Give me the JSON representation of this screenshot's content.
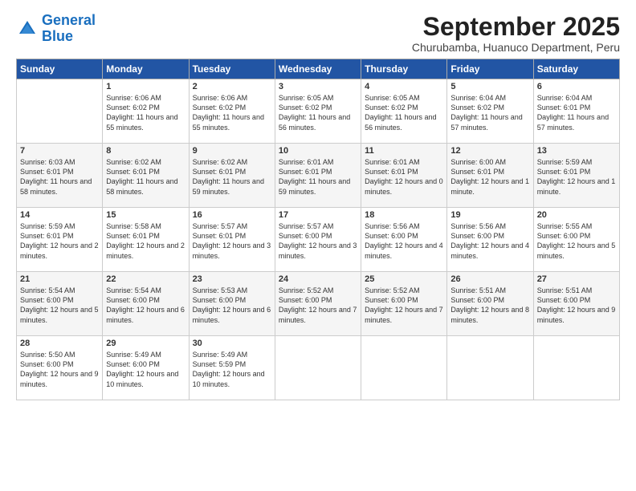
{
  "header": {
    "logo_line1": "General",
    "logo_line2": "Blue",
    "month": "September 2025",
    "location": "Churubamba, Huanuco Department, Peru"
  },
  "days_of_week": [
    "Sunday",
    "Monday",
    "Tuesday",
    "Wednesday",
    "Thursday",
    "Friday",
    "Saturday"
  ],
  "weeks": [
    [
      {
        "day": "",
        "sunrise": "",
        "sunset": "",
        "daylight": ""
      },
      {
        "day": "1",
        "sunrise": "6:06 AM",
        "sunset": "6:02 PM",
        "daylight": "11 hours and 55 minutes."
      },
      {
        "day": "2",
        "sunrise": "6:06 AM",
        "sunset": "6:02 PM",
        "daylight": "11 hours and 55 minutes."
      },
      {
        "day": "3",
        "sunrise": "6:05 AM",
        "sunset": "6:02 PM",
        "daylight": "11 hours and 56 minutes."
      },
      {
        "day": "4",
        "sunrise": "6:05 AM",
        "sunset": "6:02 PM",
        "daylight": "11 hours and 56 minutes."
      },
      {
        "day": "5",
        "sunrise": "6:04 AM",
        "sunset": "6:02 PM",
        "daylight": "11 hours and 57 minutes."
      },
      {
        "day": "6",
        "sunrise": "6:04 AM",
        "sunset": "6:01 PM",
        "daylight": "11 hours and 57 minutes."
      }
    ],
    [
      {
        "day": "7",
        "sunrise": "6:03 AM",
        "sunset": "6:01 PM",
        "daylight": "11 hours and 58 minutes."
      },
      {
        "day": "8",
        "sunrise": "6:02 AM",
        "sunset": "6:01 PM",
        "daylight": "11 hours and 58 minutes."
      },
      {
        "day": "9",
        "sunrise": "6:02 AM",
        "sunset": "6:01 PM",
        "daylight": "11 hours and 59 minutes."
      },
      {
        "day": "10",
        "sunrise": "6:01 AM",
        "sunset": "6:01 PM",
        "daylight": "11 hours and 59 minutes."
      },
      {
        "day": "11",
        "sunrise": "6:01 AM",
        "sunset": "6:01 PM",
        "daylight": "12 hours and 0 minutes."
      },
      {
        "day": "12",
        "sunrise": "6:00 AM",
        "sunset": "6:01 PM",
        "daylight": "12 hours and 1 minute."
      },
      {
        "day": "13",
        "sunrise": "5:59 AM",
        "sunset": "6:01 PM",
        "daylight": "12 hours and 1 minute."
      }
    ],
    [
      {
        "day": "14",
        "sunrise": "5:59 AM",
        "sunset": "6:01 PM",
        "daylight": "12 hours and 2 minutes."
      },
      {
        "day": "15",
        "sunrise": "5:58 AM",
        "sunset": "6:01 PM",
        "daylight": "12 hours and 2 minutes."
      },
      {
        "day": "16",
        "sunrise": "5:57 AM",
        "sunset": "6:01 PM",
        "daylight": "12 hours and 3 minutes."
      },
      {
        "day": "17",
        "sunrise": "5:57 AM",
        "sunset": "6:00 PM",
        "daylight": "12 hours and 3 minutes."
      },
      {
        "day": "18",
        "sunrise": "5:56 AM",
        "sunset": "6:00 PM",
        "daylight": "12 hours and 4 minutes."
      },
      {
        "day": "19",
        "sunrise": "5:56 AM",
        "sunset": "6:00 PM",
        "daylight": "12 hours and 4 minutes."
      },
      {
        "day": "20",
        "sunrise": "5:55 AM",
        "sunset": "6:00 PM",
        "daylight": "12 hours and 5 minutes."
      }
    ],
    [
      {
        "day": "21",
        "sunrise": "5:54 AM",
        "sunset": "6:00 PM",
        "daylight": "12 hours and 5 minutes."
      },
      {
        "day": "22",
        "sunrise": "5:54 AM",
        "sunset": "6:00 PM",
        "daylight": "12 hours and 6 minutes."
      },
      {
        "day": "23",
        "sunrise": "5:53 AM",
        "sunset": "6:00 PM",
        "daylight": "12 hours and 6 minutes."
      },
      {
        "day": "24",
        "sunrise": "5:52 AM",
        "sunset": "6:00 PM",
        "daylight": "12 hours and 7 minutes."
      },
      {
        "day": "25",
        "sunrise": "5:52 AM",
        "sunset": "6:00 PM",
        "daylight": "12 hours and 7 minutes."
      },
      {
        "day": "26",
        "sunrise": "5:51 AM",
        "sunset": "6:00 PM",
        "daylight": "12 hours and 8 minutes."
      },
      {
        "day": "27",
        "sunrise": "5:51 AM",
        "sunset": "6:00 PM",
        "daylight": "12 hours and 9 minutes."
      }
    ],
    [
      {
        "day": "28",
        "sunrise": "5:50 AM",
        "sunset": "6:00 PM",
        "daylight": "12 hours and 9 minutes."
      },
      {
        "day": "29",
        "sunrise": "5:49 AM",
        "sunset": "6:00 PM",
        "daylight": "12 hours and 10 minutes."
      },
      {
        "day": "30",
        "sunrise": "5:49 AM",
        "sunset": "5:59 PM",
        "daylight": "12 hours and 10 minutes."
      },
      {
        "day": "",
        "sunrise": "",
        "sunset": "",
        "daylight": ""
      },
      {
        "day": "",
        "sunrise": "",
        "sunset": "",
        "daylight": ""
      },
      {
        "day": "",
        "sunrise": "",
        "sunset": "",
        "daylight": ""
      },
      {
        "day": "",
        "sunrise": "",
        "sunset": "",
        "daylight": ""
      }
    ]
  ]
}
